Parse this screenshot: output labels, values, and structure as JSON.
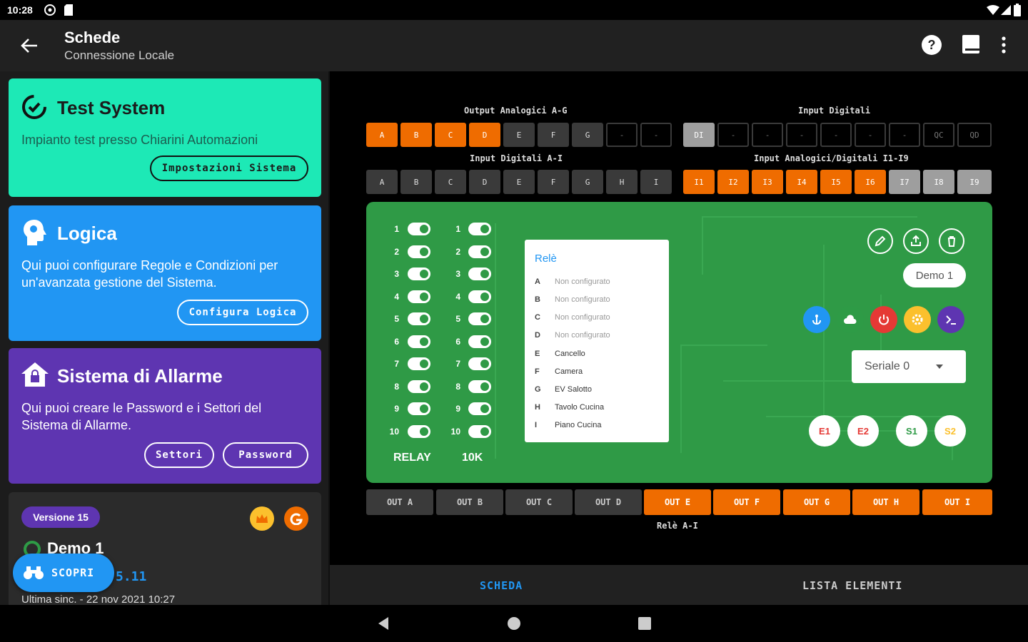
{
  "status": {
    "time": "10:28"
  },
  "appbar": {
    "title": "Schede",
    "subtitle": "Connessione Locale"
  },
  "cards": {
    "test": {
      "title": "Test System",
      "desc": "Impianto test presso Chiarini Automazioni",
      "button": "Impostazioni Sistema",
      "color": "#1de9b6"
    },
    "logica": {
      "title": "Logica",
      "desc1": "Qui puoi configurare Regole e Condizioni per",
      "desc2": "un'avanzata gestione del Sistema.",
      "button": "Configura Logica",
      "color": "#2196f3"
    },
    "allarme": {
      "title": "Sistema di Allarme",
      "desc1": "Qui puoi creare le Password e i Settori del",
      "desc2": "Sistema di Allarme.",
      "button1": "Settori",
      "button2": "Password",
      "color": "#5e35b1"
    },
    "device": {
      "version": "Versione 15",
      "name": "Demo 1",
      "ip_fragment": "5.11",
      "last_sync": "Ultima sinc. - 22 nov 2021 10:27",
      "fab": "SCOPRI"
    }
  },
  "io": {
    "output_analog_label": "Output Analogici A-G",
    "output_analog": [
      "A",
      "B",
      "C",
      "D",
      "E",
      "F",
      "G",
      "-",
      "-"
    ],
    "input_digital_label": "Input Digitali",
    "input_digital": [
      "DI",
      "-",
      "-",
      "-",
      "-",
      "-",
      "-",
      "QC",
      "QD"
    ],
    "input_digital_ai_label": "Input Digitali A-I",
    "input_digital_ai": [
      "A",
      "B",
      "C",
      "D",
      "E",
      "F",
      "G",
      "H",
      "I"
    ],
    "input_analog_label": "Input Analogici/Digitali I1-I9",
    "input_analog": [
      "I1",
      "I2",
      "I3",
      "I4",
      "I5",
      "I6",
      "I7",
      "I8",
      "I9"
    ]
  },
  "board": {
    "switch_numbers": [
      "1",
      "2",
      "3",
      "4",
      "5",
      "6",
      "7",
      "8",
      "9",
      "10"
    ],
    "relay_label": "RELAY",
    "k_label": "10K",
    "popup": {
      "title": "Relè",
      "rows": [
        {
          "letter": "A",
          "value": "Non configurato"
        },
        {
          "letter": "B",
          "value": "Non configurato"
        },
        {
          "letter": "C",
          "value": "Non configurato"
        },
        {
          "letter": "D",
          "value": "Non configurato"
        },
        {
          "letter": "E",
          "value": "Cancello"
        },
        {
          "letter": "F",
          "value": "Camera"
        },
        {
          "letter": "G",
          "value": "EV Salotto"
        },
        {
          "letter": "H",
          "value": "Tavolo Cucina"
        },
        {
          "letter": "I",
          "value": "Piano Cucina"
        }
      ]
    },
    "demo_label": "Demo 1",
    "serial_label": "Seriale 0",
    "chips": [
      "E1",
      "E2",
      "S1",
      "S2"
    ]
  },
  "outputs": [
    "OUT A",
    "OUT B",
    "OUT C",
    "OUT D",
    "OUT E",
    "OUT F",
    "OUT G",
    "OUT H",
    "OUT I"
  ],
  "relay_footer": "Relè A-I",
  "tabs": {
    "scheda": "SCHEDA",
    "lista": "LISTA ELEMENTI"
  },
  "colors": {
    "orange": "#ef6c00",
    "accent_tab": "#2196f3"
  }
}
